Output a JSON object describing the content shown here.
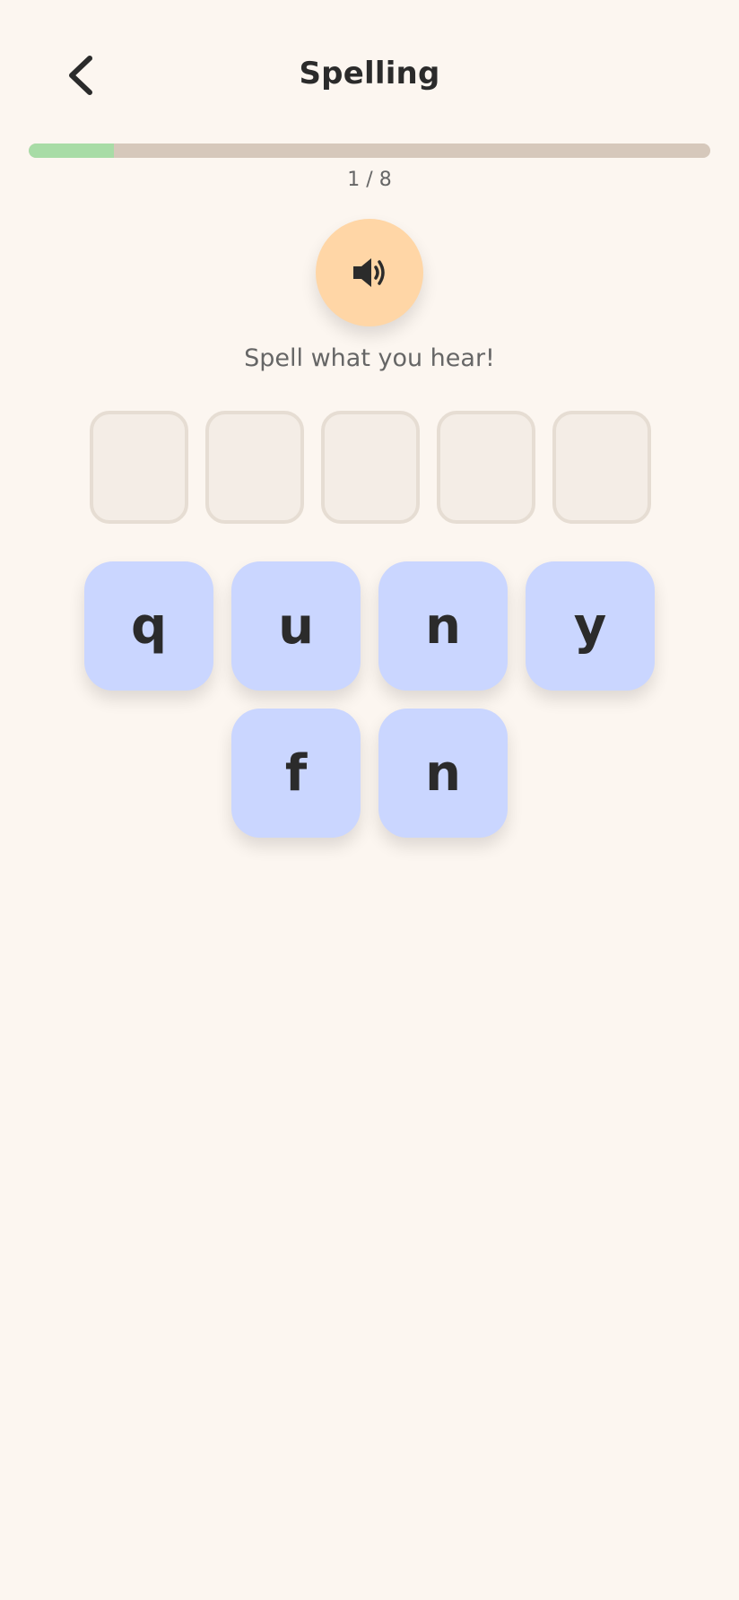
{
  "header": {
    "title": "Spelling",
    "back_icon": "chevron-left-icon"
  },
  "progress": {
    "current": 1,
    "total": 8,
    "label": "1 / 8",
    "fraction": 0.125,
    "track_color": "#d6c8bb",
    "fill_color": "#a8dca6"
  },
  "audio": {
    "icon": "speaker-icon",
    "color": "#ffd6a6"
  },
  "instruction": "Spell what you hear!",
  "answer_slots": [
    {
      "letter": ""
    },
    {
      "letter": ""
    },
    {
      "letter": ""
    },
    {
      "letter": ""
    },
    {
      "letter": ""
    }
  ],
  "tiles": {
    "row1": [
      "q",
      "u",
      "n",
      "y"
    ],
    "row2": [
      "f",
      "n"
    ],
    "color": "#cad6ff"
  }
}
